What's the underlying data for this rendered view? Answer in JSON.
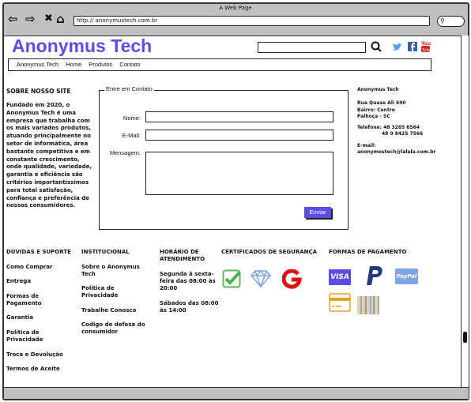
{
  "browser": {
    "title": "A Web Page",
    "url": "http://  anonymustech.com.br"
  },
  "header": {
    "logo": "Anonymus Tech",
    "search_placeholder": "",
    "nav": [
      "Anonymus Tech",
      "Home",
      "Produtos",
      "Contato"
    ]
  },
  "about": {
    "title": "SOBRE NOSSO SITE",
    "text": "Fundado em 2020, o Anonymus Tech é uma empresa que trabalha com os mais variados produtos, atuando principalmente no setor de informática, área bastante competitiva e em constante crescimento, onde qualidade, variedade, garantia e eficiência são critérios importantíssimos para total satisfação, confiança e preferência de nossos consumidores."
  },
  "contact_form": {
    "legend": "Entre em Contato",
    "name_label": "Nome:",
    "email_label": "E-Mail:",
    "message_label": "Mensagem:",
    "submit": "Enviar"
  },
  "company": {
    "name": "Anonymus Tech",
    "address": [
      "Rua Quase Ali 690",
      "Bairro: Centro",
      "Palhoça - SC"
    ],
    "phone_label": "Telefone:",
    "phones": [
      "48 3265 6564",
      "48 9 8425 7566"
    ],
    "email_label": "E-mail:",
    "email": "anonymostech@lalala.com.br"
  },
  "footer": {
    "support": {
      "title": "DÚVIDAS E SUPORTE",
      "links": [
        "Como Comprar",
        "Entrega",
        "Formas de Pagamento",
        "Garantia",
        "Política de Privacidade",
        "Troca e Devolução",
        "Termos de Aceite"
      ]
    },
    "institutional": {
      "title": "INSTITUCIONAL",
      "links": [
        "Sobre o Anonymus Tech",
        "Política de Privacidade",
        "Trabalhe Conosco",
        "Codigo de defesa do consumidor"
      ]
    },
    "hours": {
      "title": "HORÁRIO DE ATENDIMENTO",
      "lines": [
        "Segunda à sexta-feira das 08:00 às 20:00",
        "Sábados das 08:00 às 14:00"
      ]
    },
    "security": {
      "title": "CERTIFICADOS DE SEGURANÇA",
      "icons": [
        "check-certificate-icon",
        "diamond-icon",
        "google-icon"
      ]
    },
    "payment": {
      "title": "FORMAS DE PAGAMENTO",
      "visa": "VISA",
      "paypal": "PayPal",
      "icons": [
        "visa-icon",
        "paypal-p-icon",
        "paypal-icon",
        "credit-card-icon",
        "barcode-icon"
      ]
    }
  },
  "colors": {
    "brand": "#5a4ee6",
    "chrome": "#c0c0c0"
  }
}
